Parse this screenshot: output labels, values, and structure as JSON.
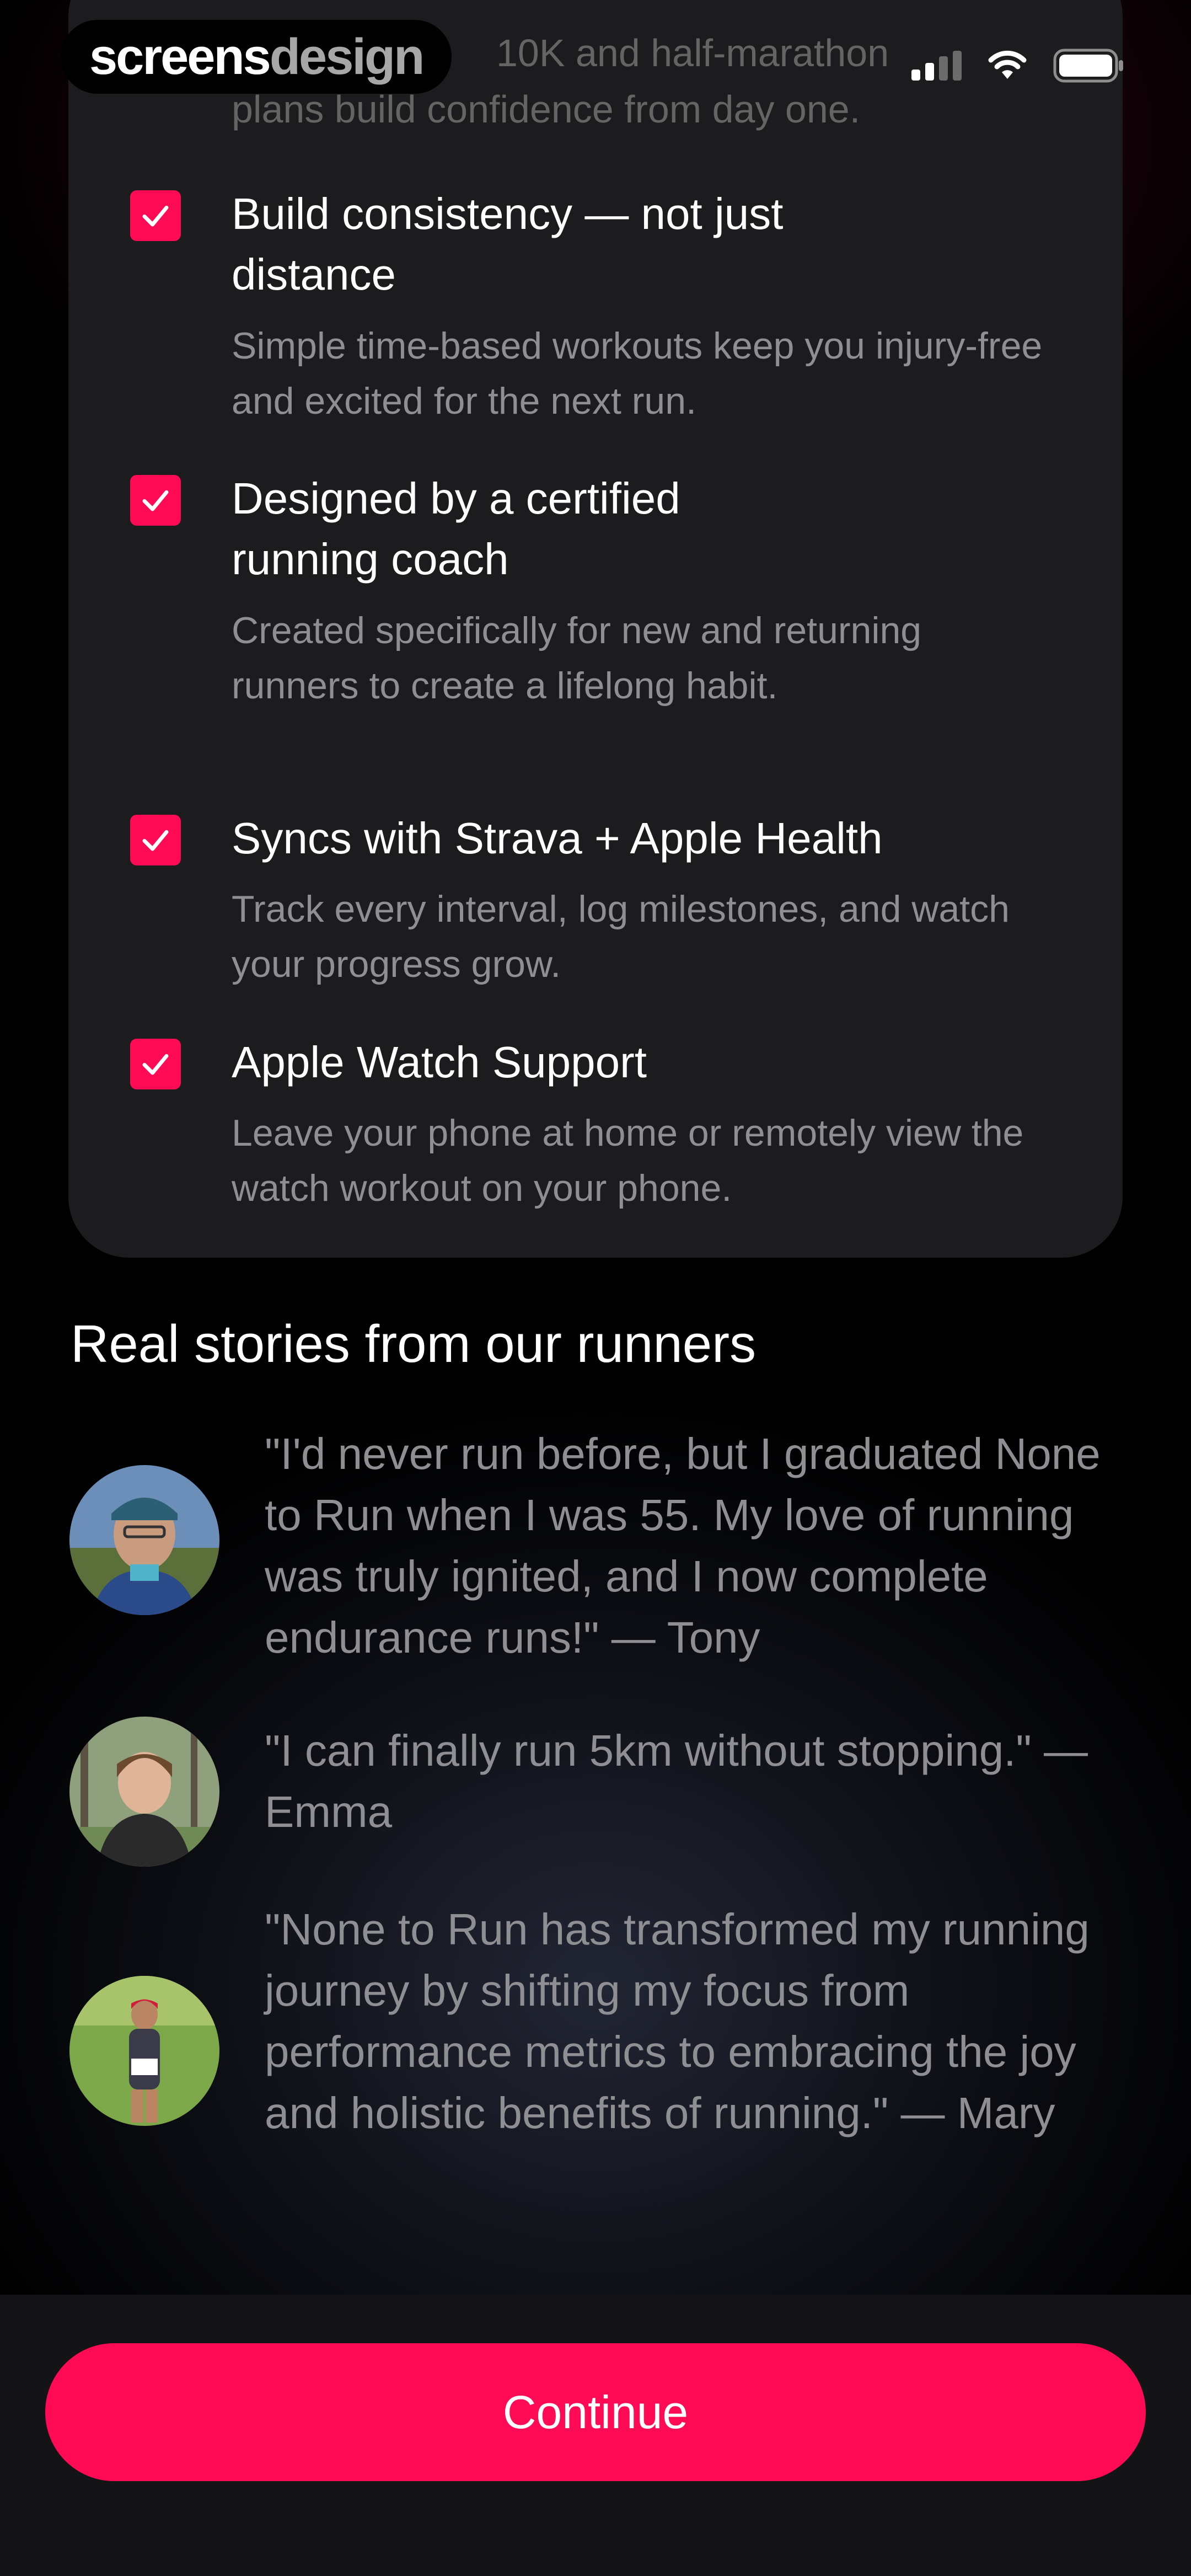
{
  "status_bar": {
    "brand_part1": "screens",
    "brand_part2": "design",
    "peek_line1": "10K and half-marathon",
    "peek_line2": "plans build confidence from day one.",
    "signal_icon": "cellular-signal-icon",
    "wifi_icon": "wifi-icon",
    "battery_icon": "battery-icon"
  },
  "features": [
    {
      "title": "Build consistency — not just distance",
      "description": "Simple time-based workouts keep you injury-free and excited for the next run.",
      "checked": true
    },
    {
      "title": "Designed by a certified running coach",
      "description": "Created specifically for new and returning runners to create a lifelong habit.",
      "checked": true
    },
    {
      "title": "Syncs with Strava + Apple Health",
      "description": "Track every interval, log milestones, and watch your progress grow.",
      "checked": true
    },
    {
      "title": "Apple Watch Support",
      "description": "Leave your phone at home or remotely view the watch workout on your phone.",
      "checked": true
    }
  ],
  "stories": {
    "title": "Real stories from our runners",
    "items": [
      {
        "quote": "\"I'd never run before, but I graduated None to Run when I was 55. My love of running was truly ignited, and I now complete endurance runs!\" — Tony"
      },
      {
        "quote": "\"I can finally run 5km without stopping.\" — Emma"
      },
      {
        "quote": "\"None to Run has transformed my running journey by shifting my focus from performance metrics to embracing the joy and holistic benefits of running.\" — Mary"
      }
    ]
  },
  "cta": {
    "continue_label": "Continue"
  },
  "colors": {
    "accent": "#ff0a54",
    "card_bg": "#1c1c1e",
    "secondary_text": "#8e8e93"
  }
}
